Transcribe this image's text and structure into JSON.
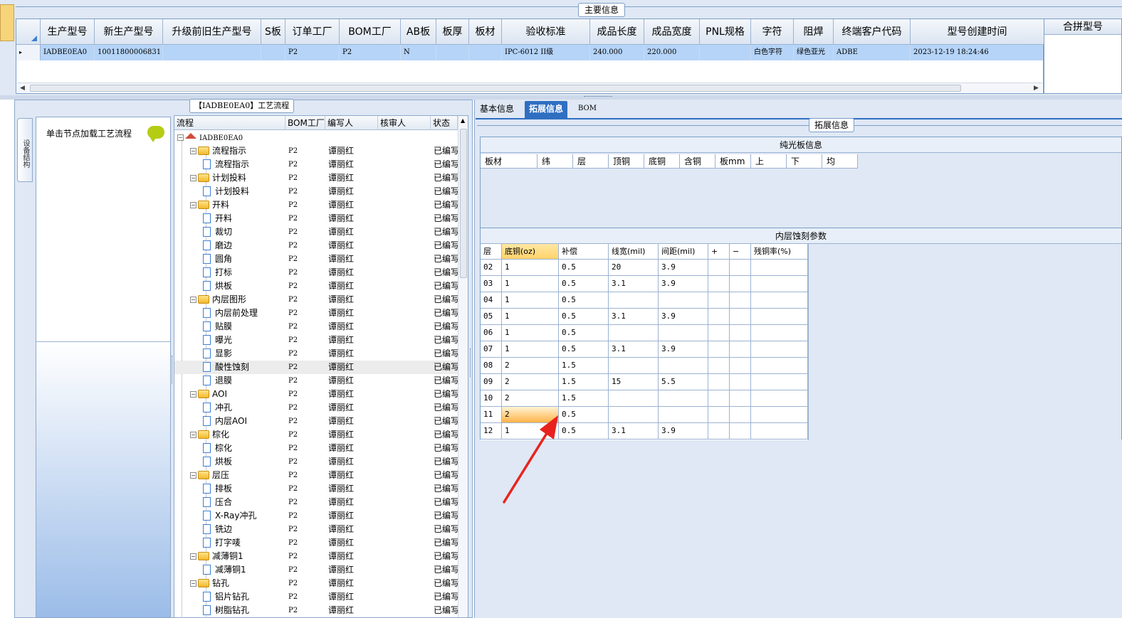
{
  "main_info": {
    "group_title": "主要信息",
    "columns": [
      "生产型号",
      "新生产型号",
      "升级前旧生产型号",
      "S板",
      "订单工厂",
      "BOM工厂",
      "AB板",
      "板厚",
      "板材",
      "验收标准",
      "成品长度",
      "成品宽度",
      "PNL规格",
      "字符",
      "阻焊",
      "终端客户代码",
      "型号创建时间"
    ],
    "row_marker": "▸",
    "row": [
      "IADBE0EA0",
      "10011800006831",
      "",
      "",
      "P2",
      "P2",
      "N",
      "",
      "",
      "IPC-6012 II级",
      "240.000",
      "220.000",
      "",
      "白色字符",
      "绿色亚光",
      "ADBE",
      "2023-12-19 18:24:46"
    ],
    "merge_header": "合拼型号",
    "scroll_left": "◀",
    "scroll_right": "▶"
  },
  "process": {
    "title": "【IADBE0EA0】工艺流程",
    "side_tab": "设备结构",
    "load_hint": "单击节点加载工艺流程",
    "columns": [
      "流程",
      "BOM工厂",
      "编写人",
      "核审人",
      "状态"
    ],
    "root": "IADBE0EA0",
    "nodes": [
      {
        "label": "流程指示",
        "bom": "P2",
        "writer": "谭丽红",
        "status": "已编写",
        "type": "group"
      },
      {
        "label": "流程指示",
        "bom": "P2",
        "writer": "谭丽红",
        "status": "已编写",
        "type": "leaf"
      },
      {
        "label": "计划投料",
        "bom": "P2",
        "writer": "谭丽红",
        "status": "已编写",
        "type": "group"
      },
      {
        "label": "计划投料",
        "bom": "P2",
        "writer": "谭丽红",
        "status": "已编写",
        "type": "leaf"
      },
      {
        "label": "开料",
        "bom": "P2",
        "writer": "谭丽红",
        "status": "已编写",
        "type": "group"
      },
      {
        "label": "开料",
        "bom": "P2",
        "writer": "谭丽红",
        "status": "已编写",
        "type": "leaf"
      },
      {
        "label": "裁切",
        "bom": "P2",
        "writer": "谭丽红",
        "status": "已编写",
        "type": "leaf"
      },
      {
        "label": "磨边",
        "bom": "P2",
        "writer": "谭丽红",
        "status": "已编写",
        "type": "leaf"
      },
      {
        "label": "圆角",
        "bom": "P2",
        "writer": "谭丽红",
        "status": "已编写",
        "type": "leaf"
      },
      {
        "label": "打标",
        "bom": "P2",
        "writer": "谭丽红",
        "status": "已编写",
        "type": "leaf"
      },
      {
        "label": "烘板",
        "bom": "P2",
        "writer": "谭丽红",
        "status": "已编写",
        "type": "leaf"
      },
      {
        "label": "内层图形",
        "bom": "P2",
        "writer": "谭丽红",
        "status": "已编写",
        "type": "group"
      },
      {
        "label": "内层前处理",
        "bom": "P2",
        "writer": "谭丽红",
        "status": "已编写",
        "type": "leaf"
      },
      {
        "label": "贴膜",
        "bom": "P2",
        "writer": "谭丽红",
        "status": "已编写",
        "type": "leaf"
      },
      {
        "label": "曝光",
        "bom": "P2",
        "writer": "谭丽红",
        "status": "已编写",
        "type": "leaf"
      },
      {
        "label": "显影",
        "bom": "P2",
        "writer": "谭丽红",
        "status": "已编写",
        "type": "leaf"
      },
      {
        "label": "酸性蚀刻",
        "bom": "P2",
        "writer": "谭丽红",
        "status": "已编写",
        "type": "leaf",
        "selected": true
      },
      {
        "label": "退膜",
        "bom": "P2",
        "writer": "谭丽红",
        "status": "已编写",
        "type": "leaf"
      },
      {
        "label": "AOI",
        "bom": "P2",
        "writer": "谭丽红",
        "status": "已编写",
        "type": "group"
      },
      {
        "label": "冲孔",
        "bom": "P2",
        "writer": "谭丽红",
        "status": "已编写",
        "type": "leaf"
      },
      {
        "label": "内层AOI",
        "bom": "P2",
        "writer": "谭丽红",
        "status": "已编写",
        "type": "leaf"
      },
      {
        "label": "棕化",
        "bom": "P2",
        "writer": "谭丽红",
        "status": "已编写",
        "type": "group"
      },
      {
        "label": "棕化",
        "bom": "P2",
        "writer": "谭丽红",
        "status": "已编写",
        "type": "leaf"
      },
      {
        "label": "烘板",
        "bom": "P2",
        "writer": "谭丽红",
        "status": "已编写",
        "type": "leaf"
      },
      {
        "label": "层压",
        "bom": "P2",
        "writer": "谭丽红",
        "status": "已编写",
        "type": "group"
      },
      {
        "label": "排板",
        "bom": "P2",
        "writer": "谭丽红",
        "status": "已编写",
        "type": "leaf"
      },
      {
        "label": "压合",
        "bom": "P2",
        "writer": "谭丽红",
        "status": "已编写",
        "type": "leaf"
      },
      {
        "label": "X-Ray冲孔",
        "bom": "P2",
        "writer": "谭丽红",
        "status": "已编写",
        "type": "leaf"
      },
      {
        "label": "铣边",
        "bom": "P2",
        "writer": "谭丽红",
        "status": "已编写",
        "type": "leaf"
      },
      {
        "label": "打字唛",
        "bom": "P2",
        "writer": "谭丽红",
        "status": "已编写",
        "type": "leaf"
      },
      {
        "label": "减薄铜1",
        "bom": "P2",
        "writer": "谭丽红",
        "status": "已编写",
        "type": "group"
      },
      {
        "label": "减薄铜1",
        "bom": "P2",
        "writer": "谭丽红",
        "status": "已编写",
        "type": "leaf"
      },
      {
        "label": "钻孔",
        "bom": "P2",
        "writer": "谭丽红",
        "status": "已编写",
        "type": "group"
      },
      {
        "label": "铝片钻孔",
        "bom": "P2",
        "writer": "谭丽红",
        "status": "已编写",
        "type": "leaf"
      },
      {
        "label": "树脂钻孔",
        "bom": "P2",
        "writer": "谭丽红",
        "status": "已编写",
        "type": "leaf"
      }
    ]
  },
  "tabs": [
    "基本信息",
    "拓展信息",
    "BOM"
  ],
  "active_tab": 1,
  "extended": {
    "group_title": "拓展信息",
    "bare_board": {
      "title": "纯光板信息",
      "columns": [
        "板材",
        "纬",
        "层",
        "顶铜",
        "底铜",
        "含铜",
        "板mm",
        "上",
        "下",
        "均"
      ]
    },
    "etch": {
      "title": "内层蚀刻参数",
      "columns": [
        "层",
        "底铜(oz)",
        "补偿",
        "线宽(mil)",
        "间距(mil)",
        "+",
        "−",
        "残铜率(%)"
      ],
      "rows": [
        [
          "02",
          "1",
          "0.5",
          "20",
          "3.9",
          "",
          "",
          ""
        ],
        [
          "03",
          "1",
          "0.5",
          "3.1",
          "3.9",
          "",
          "",
          ""
        ],
        [
          "04",
          "1",
          "0.5",
          "",
          "",
          "",
          "",
          ""
        ],
        [
          "05",
          "1",
          "0.5",
          "3.1",
          "3.9",
          "",
          "",
          ""
        ],
        [
          "06",
          "1",
          "0.5",
          "",
          "",
          "",
          "",
          ""
        ],
        [
          "07",
          "1",
          "0.5",
          "3.1",
          "3.9",
          "",
          "",
          ""
        ],
        [
          "08",
          "2",
          "1.5",
          "",
          "",
          "",
          "",
          ""
        ],
        [
          "09",
          "2",
          "1.5",
          "15",
          "5.5",
          "",
          "",
          ""
        ],
        [
          "10",
          "2",
          "1.5",
          "",
          "",
          "",
          "",
          ""
        ],
        [
          "11",
          "2",
          "0.5",
          "",
          "",
          "",
          "",
          ""
        ],
        [
          "12",
          "1",
          "0.5",
          "3.1",
          "3.9",
          "",
          "",
          ""
        ]
      ],
      "active_row": 9,
      "active_col": 1
    }
  },
  "colors": {
    "accent": "#2f6fc2",
    "row_selected": "#b5d4f8",
    "annotation_arrow": "#e8231d"
  }
}
